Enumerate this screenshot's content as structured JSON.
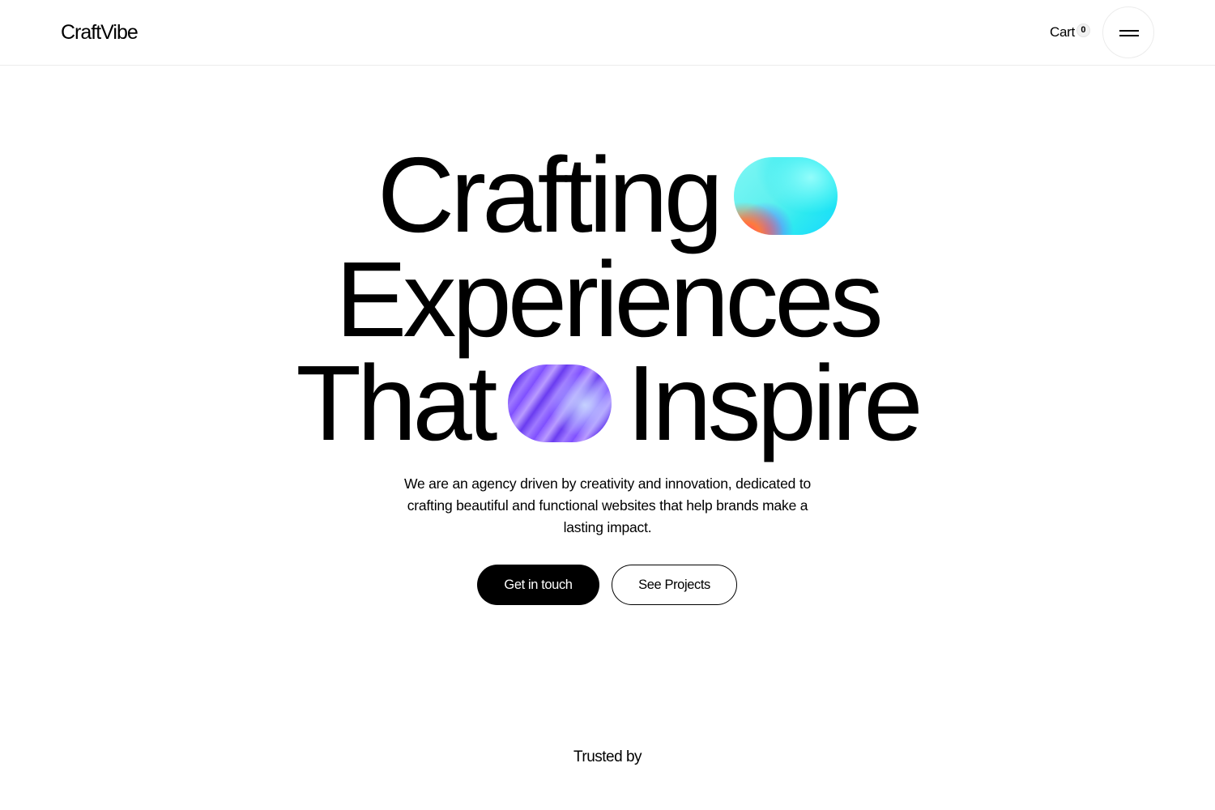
{
  "header": {
    "logo": "CraftVibe",
    "cart_label": "Cart",
    "cart_count": "0",
    "menu_icon": "hamburger-icon"
  },
  "hero": {
    "line1": "Crafting",
    "line2": "Experiences",
    "line3_word1": "That",
    "line3_word2": "Inspire",
    "description": "We are an agency driven by creativity and innovation, dedicated to crafting beautiful and functional websites that help brands make a lasting impact.",
    "primary_button": "Get in touch",
    "secondary_button": "See Projects"
  },
  "trusted": {
    "heading": "Trusted by"
  },
  "colors": {
    "background": "#ffffff",
    "text": "#000000",
    "primary_button_bg": "#000000",
    "primary_button_text": "#ffffff"
  }
}
